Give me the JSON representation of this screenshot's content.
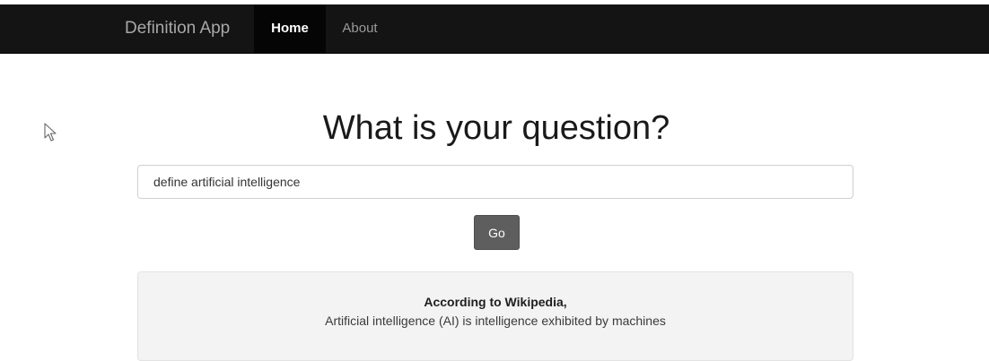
{
  "navbar": {
    "brand": "Definition App",
    "items": [
      {
        "label": "Home",
        "active": true
      },
      {
        "label": "About",
        "active": false
      }
    ]
  },
  "cursor": {
    "icon": "mouse-pointer-icon"
  },
  "main": {
    "title": "What is your question?",
    "search": {
      "value": "define artificial intelligence"
    },
    "go_label": "Go"
  },
  "result": {
    "heading": "According to Wikipedia,",
    "text": "Artificial intelligence (AI) is intelligence exhibited by machines"
  },
  "colors": {
    "navbar_bg": "#141414",
    "active_nav_bg": "#050505",
    "button_bg": "#5e5e5e",
    "result_bg": "#f3f3f3"
  }
}
